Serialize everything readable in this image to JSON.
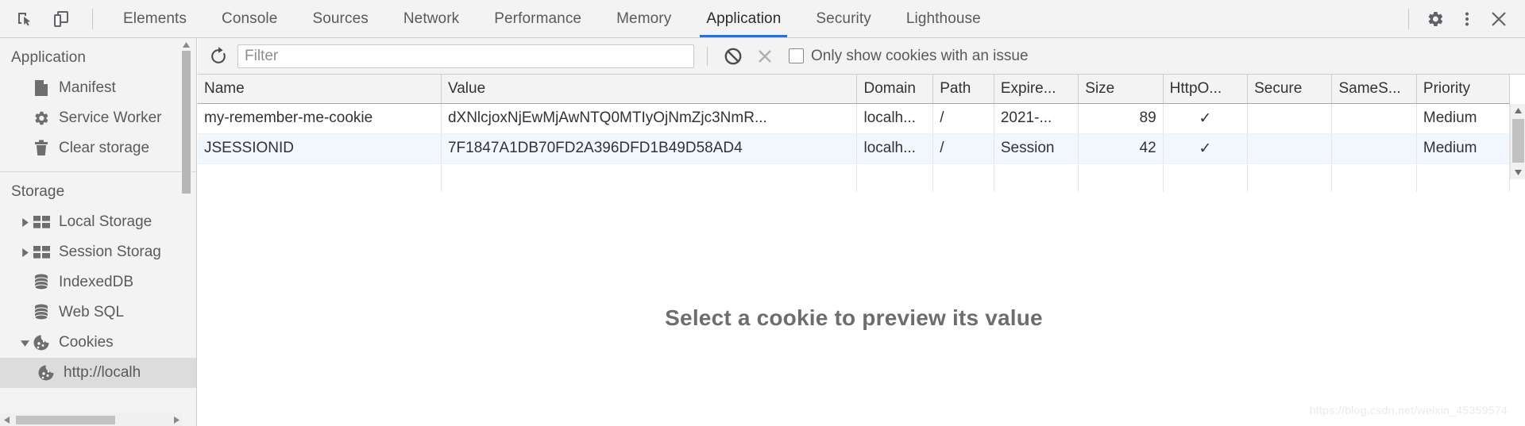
{
  "toolbar": {
    "inspect_icon": "inspect-element-icon",
    "device_icon": "device-toolbar-icon",
    "settings_icon": "gear-icon",
    "more_icon": "more-options-icon",
    "close_icon": "close-icon",
    "tabs": [
      {
        "label": "Elements",
        "selected": false
      },
      {
        "label": "Console",
        "selected": false
      },
      {
        "label": "Sources",
        "selected": false
      },
      {
        "label": "Network",
        "selected": false
      },
      {
        "label": "Performance",
        "selected": false
      },
      {
        "label": "Memory",
        "selected": false
      },
      {
        "label": "Application",
        "selected": true
      },
      {
        "label": "Security",
        "selected": false
      },
      {
        "label": "Lighthouse",
        "selected": false
      }
    ],
    "accent_color": "#1a73e8"
  },
  "sidebar": {
    "sections": [
      {
        "title": "Application",
        "items": [
          {
            "label": "Manifest",
            "icon": "manifest-document-icon",
            "twisty": "none",
            "selected": false
          },
          {
            "label": "Service Worker",
            "icon": "gear-icon",
            "twisty": "none",
            "selected": false
          },
          {
            "label": "Clear storage",
            "icon": "trash-icon",
            "twisty": "none",
            "selected": false
          }
        ]
      },
      {
        "title": "Storage",
        "items": [
          {
            "label": "Local Storage",
            "icon": "table-storage-icon",
            "twisty": "collapsed",
            "selected": false
          },
          {
            "label": "Session Storag",
            "icon": "table-storage-icon",
            "twisty": "collapsed",
            "selected": false
          },
          {
            "label": "IndexedDB",
            "icon": "database-icon",
            "twisty": "none",
            "selected": false
          },
          {
            "label": "Web SQL",
            "icon": "database-icon",
            "twisty": "none",
            "selected": false
          },
          {
            "label": "Cookies",
            "icon": "cookie-icon",
            "twisty": "expanded",
            "selected": false
          },
          {
            "label": "http://localh",
            "icon": "cookie-icon",
            "twisty": "none",
            "selected": true,
            "indent": 2
          }
        ]
      }
    ]
  },
  "filterbar": {
    "refresh_icon": "refresh-icon",
    "clear_all_icon": "clear-all-cookies-icon",
    "clear_filtered_icon": "clear-filtered-icon",
    "filter_placeholder": "Filter",
    "filter_value": "",
    "checkbox_label": "Only show cookies with an issue",
    "checkbox_checked": false
  },
  "table": {
    "columns": [
      "Name",
      "Value",
      "Domain",
      "Path",
      "Expire...",
      "Size",
      "HttpO...",
      "Secure",
      "SameS...",
      "Priority"
    ],
    "rows": [
      {
        "name": "my-remember-me-cookie",
        "value": "dXNlcjoxNjEwMjAwNTQ0MTIyOjNmZjc3NmR...",
        "domain": "localh...",
        "path": "/",
        "expires": "2021-...",
        "size": "89",
        "httponly": "✓",
        "secure": "",
        "samesite": "",
        "priority": "Medium"
      },
      {
        "name": "JSESSIONID",
        "value": "7F1847A1DB70FD2A396DFD1B49D58AD4",
        "domain": "localh...",
        "path": "/",
        "expires": "Session",
        "size": "42",
        "httponly": "✓",
        "secure": "",
        "samesite": "",
        "priority": "Medium"
      }
    ]
  },
  "preview": {
    "message": "Select a cookie to preview its value"
  },
  "watermark": {
    "text": "https://blog.csdn.net/weixin_45359574"
  }
}
